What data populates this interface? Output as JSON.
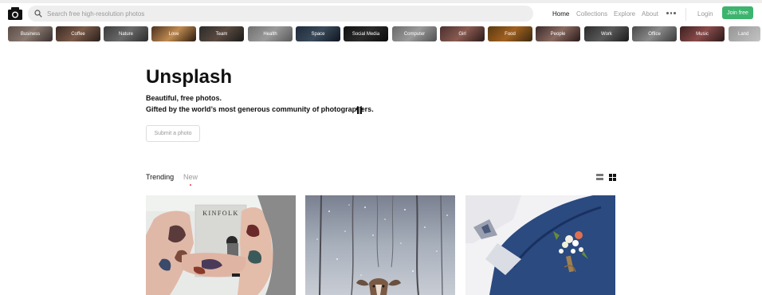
{
  "header": {
    "logo_icon": "camera-icon",
    "search_placeholder": "Search free high-resolution photos",
    "nav": [
      "Home",
      "Collections",
      "Explore",
      "About"
    ],
    "more_icon": "more-dots-icon",
    "login": "Login",
    "join": "Join free",
    "join_color": "#3cb46e"
  },
  "categories": [
    "Business",
    "Coffee",
    "Nature",
    "Love",
    "Team",
    "Health",
    "Space",
    "Social Media",
    "Computer",
    "Girl",
    "Food",
    "People",
    "Work",
    "Office",
    "Music",
    "Land"
  ],
  "hero": {
    "title": "Unsplash",
    "line1": "Beautiful, free photos.",
    "line2": "Gifted by the world’s most generous community of photographers.",
    "gift_icon": "gift-icon",
    "submit": "Submit a photo"
  },
  "feed": {
    "tabs": [
      "Trending",
      "New"
    ],
    "active_tab": "Trending",
    "view_icons": [
      "list-view-icon",
      "grid-view-icon"
    ],
    "photos": [
      {
        "subject": "tattooed arms holding book",
        "book_text": "KINFOLK"
      },
      {
        "subject": "deer in snowy forest"
      },
      {
        "subject": "flower boutonniere on blue suit"
      }
    ]
  }
}
